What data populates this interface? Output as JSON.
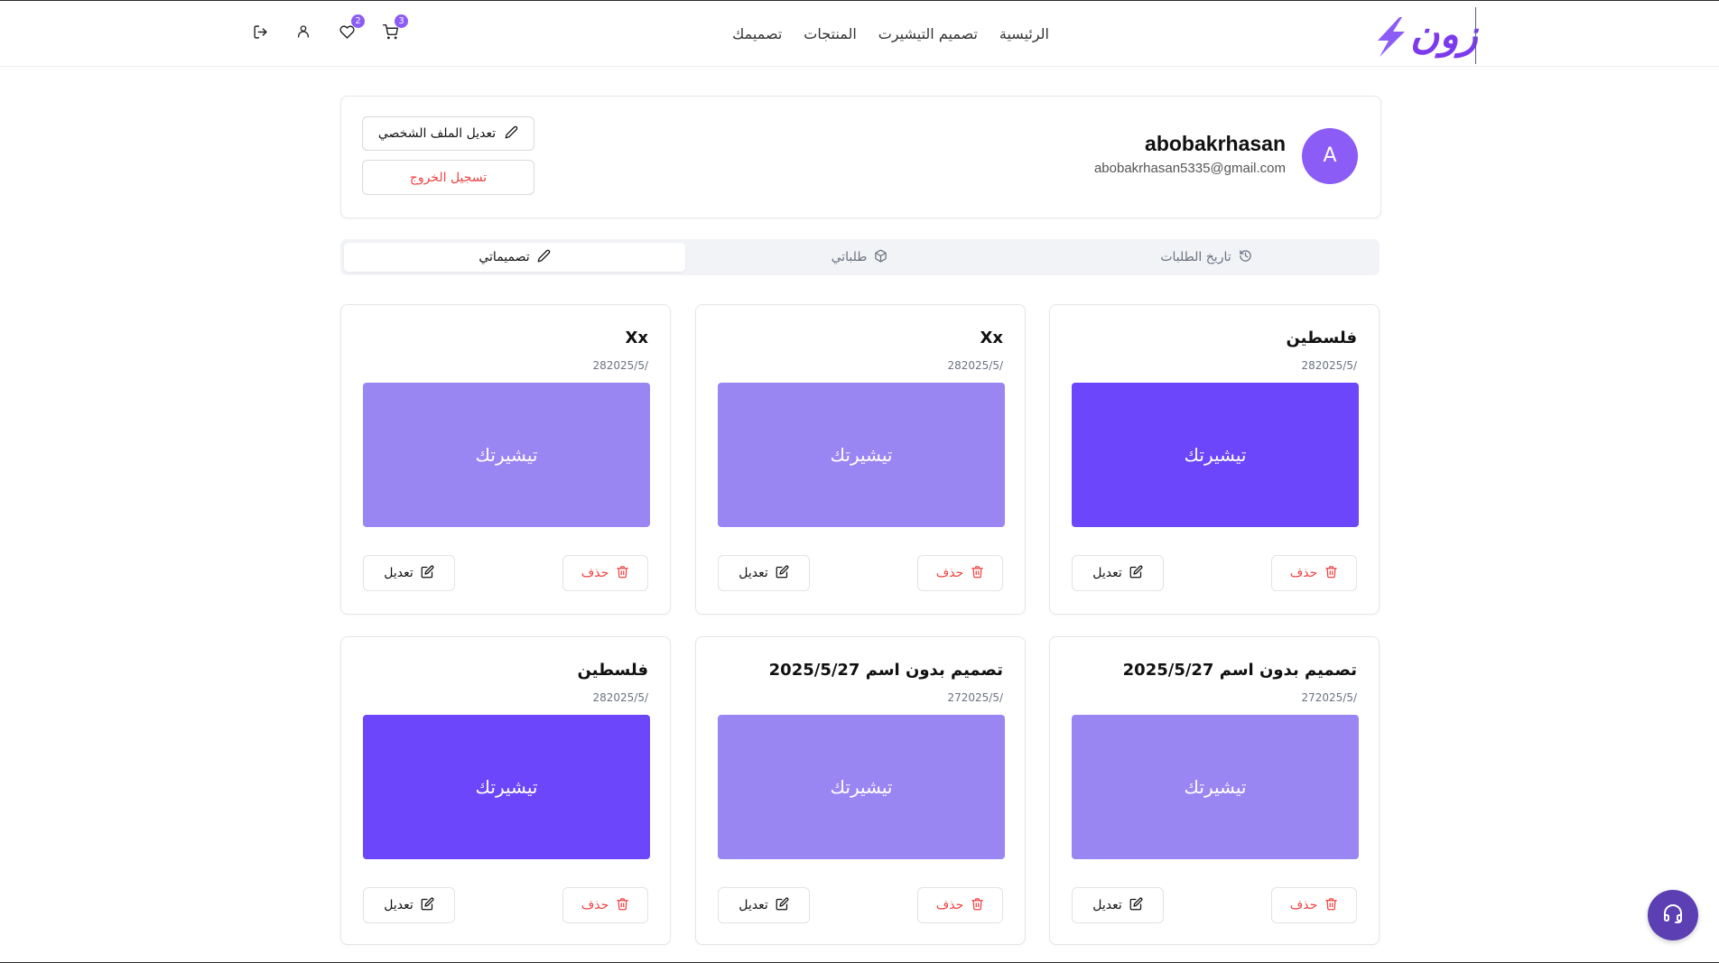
{
  "brand": {
    "logo_text": "زون",
    "accent": "#7c3aed"
  },
  "nav": [
    "الرئيسية",
    "تصميم التيشيرت",
    "المنتجات",
    "تصميمك"
  ],
  "header_icons": {
    "cart_count": "3",
    "wishlist_count": "2"
  },
  "profile": {
    "avatar_letter": "A",
    "username": "abobakrhasan",
    "email": "abobakrhasan5335@gmail.com",
    "edit_label": "تعديل الملف الشخصي",
    "logout_label": "تسجيل الخروج"
  },
  "tabs": [
    {
      "label": "تاريخ الطلبات",
      "icon": "history-icon"
    },
    {
      "label": "طلباتي",
      "icon": "package-icon"
    },
    {
      "label": "تصميماتي",
      "icon": "pencil-icon",
      "active": true
    }
  ],
  "cards": [
    {
      "title": "فلسطين",
      "date": "282025/5/",
      "image_label": "تيشيرتك",
      "color": "#6b46fb"
    },
    {
      "title": "Xx",
      "date": "282025/5/",
      "image_label": "تيشيرتك",
      "color": "#9a86f2"
    },
    {
      "title": "Xx",
      "date": "282025/5/",
      "image_label": "تيشيرتك",
      "color": "#9a86f2"
    },
    {
      "title": "تصميم بدون اسم 2025/5/27",
      "date": "272025/5/",
      "image_label": "تيشيرتك",
      "color": "#9a86f2"
    },
    {
      "title": "تصميم بدون اسم 2025/5/27",
      "date": "272025/5/",
      "image_label": "تيشيرتك",
      "color": "#9a86f2"
    },
    {
      "title": "فلسطين",
      "date": "282025/5/",
      "image_label": "تيشيرتك",
      "color": "#6b46fb"
    }
  ],
  "card_actions": {
    "delete_label": "حذف",
    "edit_label": "تعديل"
  },
  "colors": {
    "danger": "#ef4444",
    "support_button": "#5b3fb3"
  }
}
